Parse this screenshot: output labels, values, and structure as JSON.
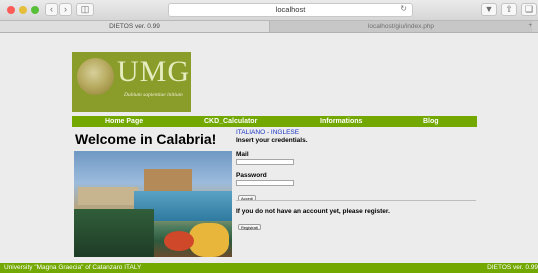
{
  "browser": {
    "address": "localhost",
    "tabs": [
      {
        "label": "DIETOS ver. 0.99"
      },
      {
        "label": "localhost/giu/index.php"
      }
    ],
    "icons": [
      "back-icon",
      "forward-icon",
      "sidebar-icon",
      "reload-icon",
      "download-icon",
      "share-icon",
      "tabs-icon"
    ]
  },
  "logo": {
    "text": "UMG",
    "motto": "Dubium sapientiae initium"
  },
  "nav": {
    "items": [
      {
        "label": "Home Page"
      },
      {
        "label": "CKD_Calculator"
      },
      {
        "label": "Informations"
      },
      {
        "label": "Blog"
      }
    ]
  },
  "main": {
    "welcome": "Welcome in Calabria!"
  },
  "login": {
    "language": "ITALIANO - INGLESE",
    "insert": "Insert your credentials.",
    "mail_label": "Mail",
    "mail_value": "",
    "password_label": "Password",
    "password_value": "",
    "access_button": "Accedi",
    "register_text": "If you do not have an account yet, please register.",
    "register_button": "Registrati"
  },
  "footer": {
    "left": "University \"Magna Graecia\" of Catanzaro ITALY",
    "right": "DIETOS ver. 0.99"
  },
  "colors": {
    "nav_green": "#72a800",
    "logo_green": "#8a9c2a",
    "language_link": "#1a35c6"
  }
}
